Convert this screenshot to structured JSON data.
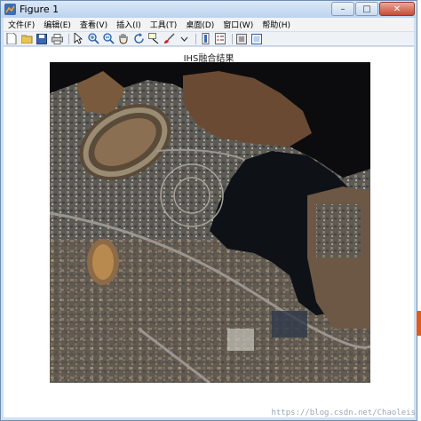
{
  "window": {
    "title": "Figure 1",
    "icons": {
      "app": "matlab-figure-icon",
      "minimize": "minimize-icon",
      "maximize": "maximize-icon",
      "close": "close-icon"
    }
  },
  "menu": {
    "items": [
      "文件(F)",
      "编辑(E)",
      "查看(V)",
      "插入(I)",
      "工具(T)",
      "桌面(D)",
      "窗口(W)",
      "帮助(H)"
    ]
  },
  "toolbar": {
    "buttons": [
      "new-figure-icon",
      "open-icon",
      "save-icon",
      "print-icon",
      "pointer-icon",
      "zoom-in-icon",
      "zoom-out-icon",
      "pan-icon",
      "rotate-icon",
      "data-cursor-icon",
      "brush-icon",
      "link-icon",
      "colorbar-icon",
      "legend-icon",
      "hide-plot-tools-icon",
      "show-plot-tools-icon"
    ]
  },
  "figure": {
    "axes_title": "IHS融合结果",
    "image": "satellite-image"
  },
  "watermark": "https://blog.csdn.net/Chaoleis",
  "colors": {
    "accent": "#e25a1c",
    "titlebar": "#bcd3ee"
  }
}
